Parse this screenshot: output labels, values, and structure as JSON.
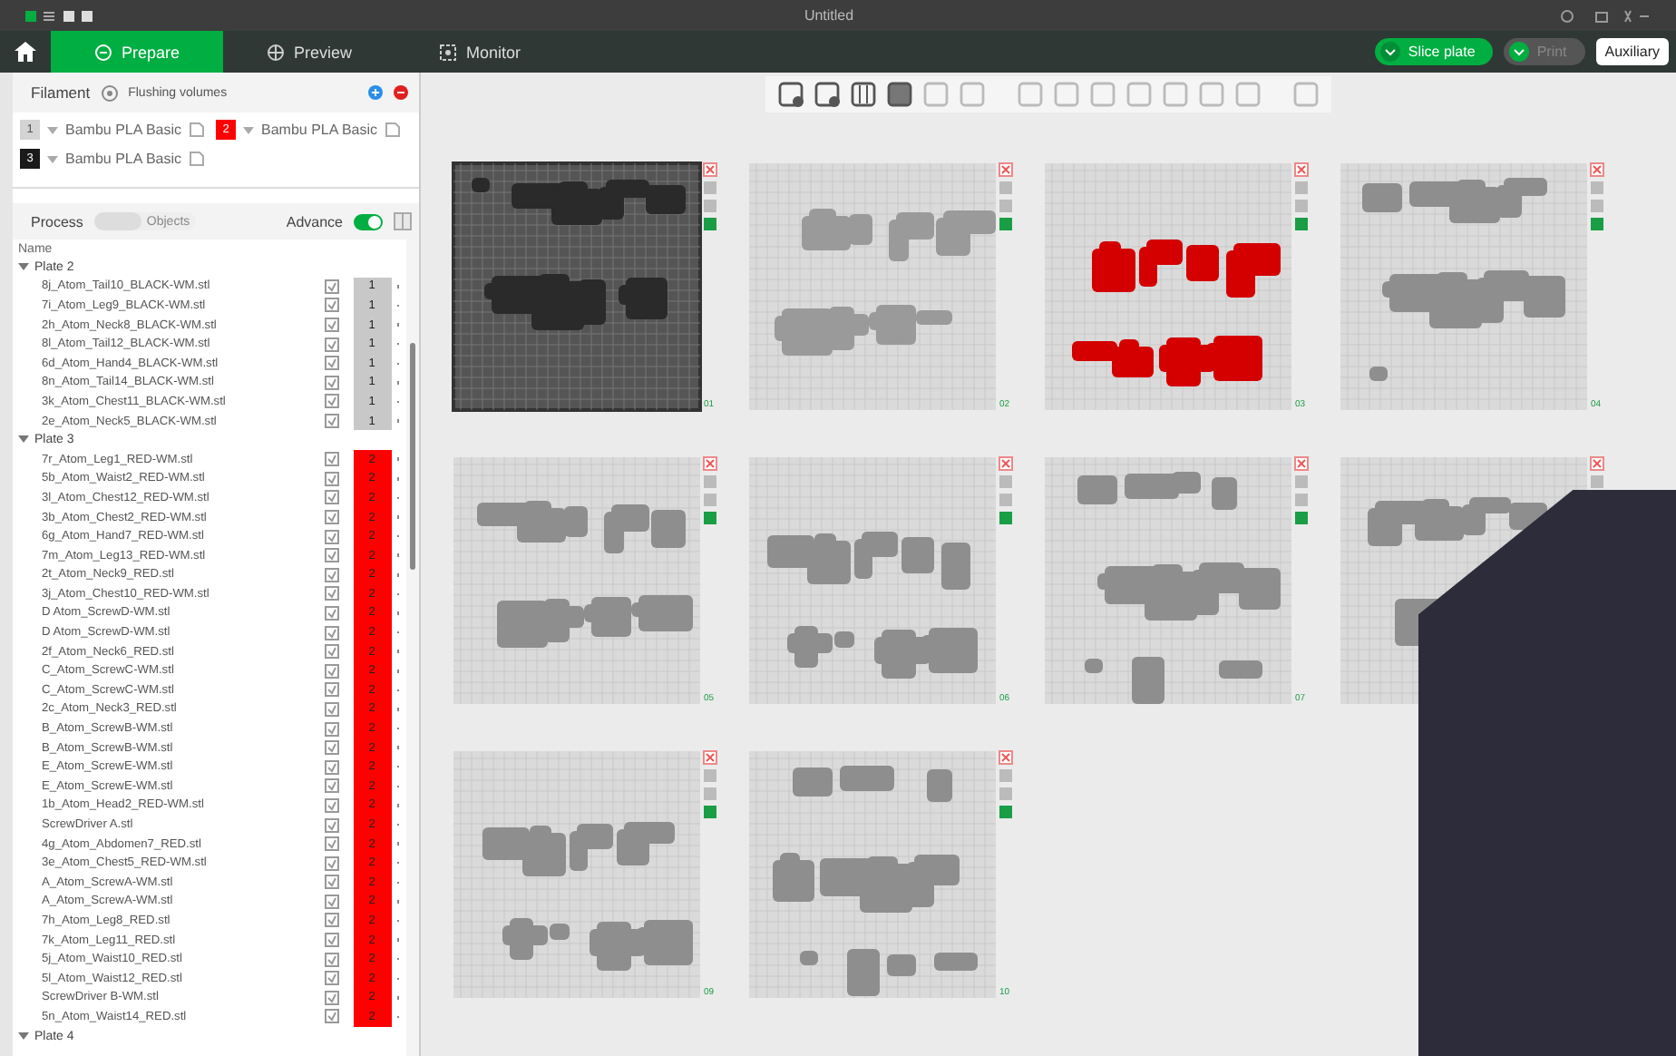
{
  "window": {
    "title": "Untitled"
  },
  "tabs": [
    {
      "label": "Prepare",
      "selected": true
    },
    {
      "label": "Preview",
      "selected": false
    },
    {
      "label": "Monitor",
      "selected": false
    }
  ],
  "actions": [
    {
      "label": "Slice plate",
      "disabled": false
    },
    {
      "label": "Print",
      "disabled": true
    }
  ],
  "auxiliary_button": "Auxiliary",
  "filament_panel": {
    "title": "Filament",
    "flushing_button": "Flushing volumes",
    "filaments": [
      {
        "slot": "1",
        "name": "Bambu PLA Basic",
        "color": "#d4d4d4"
      },
      {
        "slot": "2",
        "name": "Bambu PLA Basic",
        "color": "#ff0000"
      },
      {
        "slot": "3",
        "name": "Bambu PLA Basic",
        "color": "#1a1a1a"
      }
    ]
  },
  "process_panel": {
    "title": "Process",
    "mode_objects": "Objects",
    "objects_selected": false,
    "advance_label": "Advance",
    "advance_on": true
  },
  "object_list": {
    "column": "Name",
    "plates": [
      {
        "name": "Plate 2",
        "expanded": true,
        "objects": [
          {
            "name": "8j_Atom_Tail10_BLACK-WM.stl",
            "filament": "1",
            "color": "#c8c8c8"
          },
          {
            "name": "7i_Atom_Leg9_BLACK-WM.stl",
            "filament": "1",
            "color": "#c8c8c8"
          },
          {
            "name": "2h_Atom_Neck8_BLACK-WM.stl",
            "filament": "1",
            "color": "#c8c8c8"
          },
          {
            "name": "8l_Atom_Tail12_BLACK-WM.stl",
            "filament": "1",
            "color": "#c8c8c8"
          },
          {
            "name": "6d_Atom_Hand4_BLACK-WM.stl",
            "filament": "1",
            "color": "#c8c8c8"
          },
          {
            "name": "8n_Atom_Tail14_BLACK-WM.stl",
            "filament": "1",
            "color": "#c8c8c8"
          },
          {
            "name": "3k_Atom_Chest11_BLACK-WM.stl",
            "filament": "1",
            "color": "#c8c8c8"
          },
          {
            "name": "2e_Atom_Neck5_BLACK-WM.stl",
            "filament": "1",
            "color": "#c8c8c8"
          }
        ]
      },
      {
        "name": "Plate 3",
        "expanded": true,
        "objects": [
          {
            "name": "7r_Atom_Leg1_RED-WM.stl",
            "filament": "2",
            "color": "#ff0000"
          },
          {
            "name": "5b_Atom_Waist2_RED-WM.stl",
            "filament": "2",
            "color": "#ff0000"
          },
          {
            "name": "3l_Atom_Chest12_RED-WM.stl",
            "filament": "2",
            "color": "#ff0000"
          },
          {
            "name": "3b_Atom_Chest2_RED-WM.stl",
            "filament": "2",
            "color": "#ff0000"
          },
          {
            "name": "6g_Atom_Hand7_RED-WM.stl",
            "filament": "2",
            "color": "#ff0000"
          },
          {
            "name": "7m_Atom_Leg13_RED-WM.stl",
            "filament": "2",
            "color": "#ff0000"
          },
          {
            "name": "2t_Atom_Neck9_RED.stl",
            "filament": "2",
            "color": "#ff0000"
          },
          {
            "name": "3j_Atom_Chest10_RED-WM.stl",
            "filament": "2",
            "color": "#ff0000"
          },
          {
            "name": "D Atom_ScrewD-WM.stl",
            "filament": "2",
            "color": "#ff0000"
          },
          {
            "name": "D Atom_ScrewD-WM.stl",
            "filament": "2",
            "color": "#ff0000"
          },
          {
            "name": "2f_Atom_Neck6_RED.stl",
            "filament": "2",
            "color": "#ff0000"
          },
          {
            "name": "C_Atom_ScrewC-WM.stl",
            "filament": "2",
            "color": "#ff0000"
          },
          {
            "name": "C_Atom_ScrewC-WM.stl",
            "filament": "2",
            "color": "#ff0000"
          },
          {
            "name": "2c_Atom_Neck3_RED.stl",
            "filament": "2",
            "color": "#ff0000"
          },
          {
            "name": "B_Atom_ScrewB-WM.stl",
            "filament": "2",
            "color": "#ff0000"
          },
          {
            "name": "B_Atom_ScrewB-WM.stl",
            "filament": "2",
            "color": "#ff0000"
          },
          {
            "name": "E_Atom_ScrewE-WM.stl",
            "filament": "2",
            "color": "#ff0000"
          },
          {
            "name": "E_Atom_ScrewE-WM.stl",
            "filament": "2",
            "color": "#ff0000"
          },
          {
            "name": "1b_Atom_Head2_RED-WM.stl",
            "filament": "2",
            "color": "#ff0000"
          },
          {
            "name": "ScrewDriver A.stl",
            "filament": "2",
            "color": "#ff0000"
          },
          {
            "name": "4g_Atom_Abdomen7_RED.stl",
            "filament": "2",
            "color": "#ff0000"
          },
          {
            "name": "3e_Atom_Chest5_RED-WM.stl",
            "filament": "2",
            "color": "#ff0000"
          },
          {
            "name": "A_Atom_ScrewA-WM.stl",
            "filament": "2",
            "color": "#ff0000"
          },
          {
            "name": "A_Atom_ScrewA-WM.stl",
            "filament": "2",
            "color": "#ff0000"
          },
          {
            "name": "7h_Atom_Leg8_RED.stl",
            "filament": "2",
            "color": "#ff0000"
          },
          {
            "name": "7k_Atom_Leg11_RED.stl",
            "filament": "2",
            "color": "#ff0000"
          },
          {
            "name": "5j_Atom_Waist10_RED.stl",
            "filament": "2",
            "color": "#ff0000"
          },
          {
            "name": "5l_Atom_Waist12_RED.stl",
            "filament": "2",
            "color": "#ff0000"
          },
          {
            "name": "ScrewDriver B-WM.stl",
            "filament": "2",
            "color": "#ff0000"
          },
          {
            "name": "5n_Atom_Waist14_RED.stl",
            "filament": "2",
            "color": "#ff0000"
          }
        ]
      },
      {
        "name": "Plate 4",
        "expanded": true
      }
    ]
  },
  "plates": [
    {
      "label": "01",
      "selected": true,
      "color": "#2a2a2a"
    },
    {
      "label": "02",
      "selected": false,
      "color": "#9a9a9a"
    },
    {
      "label": "03",
      "selected": false,
      "color": "#d40000"
    },
    {
      "label": "04",
      "selected": false,
      "color": "#8e8e8e"
    },
    {
      "label": "05",
      "selected": false,
      "color": "#8e8e8e"
    },
    {
      "label": "06",
      "selected": false,
      "color": "#8e8e8e"
    },
    {
      "label": "07",
      "selected": false,
      "color": "#8e8e8e"
    },
    {
      "selected": false,
      "color": "#8e8e8e"
    },
    {
      "label": "09",
      "selected": false,
      "color": "#8e8e8e"
    },
    {
      "label": "10",
      "selected": false,
      "color": "#8e8e8e"
    }
  ]
}
